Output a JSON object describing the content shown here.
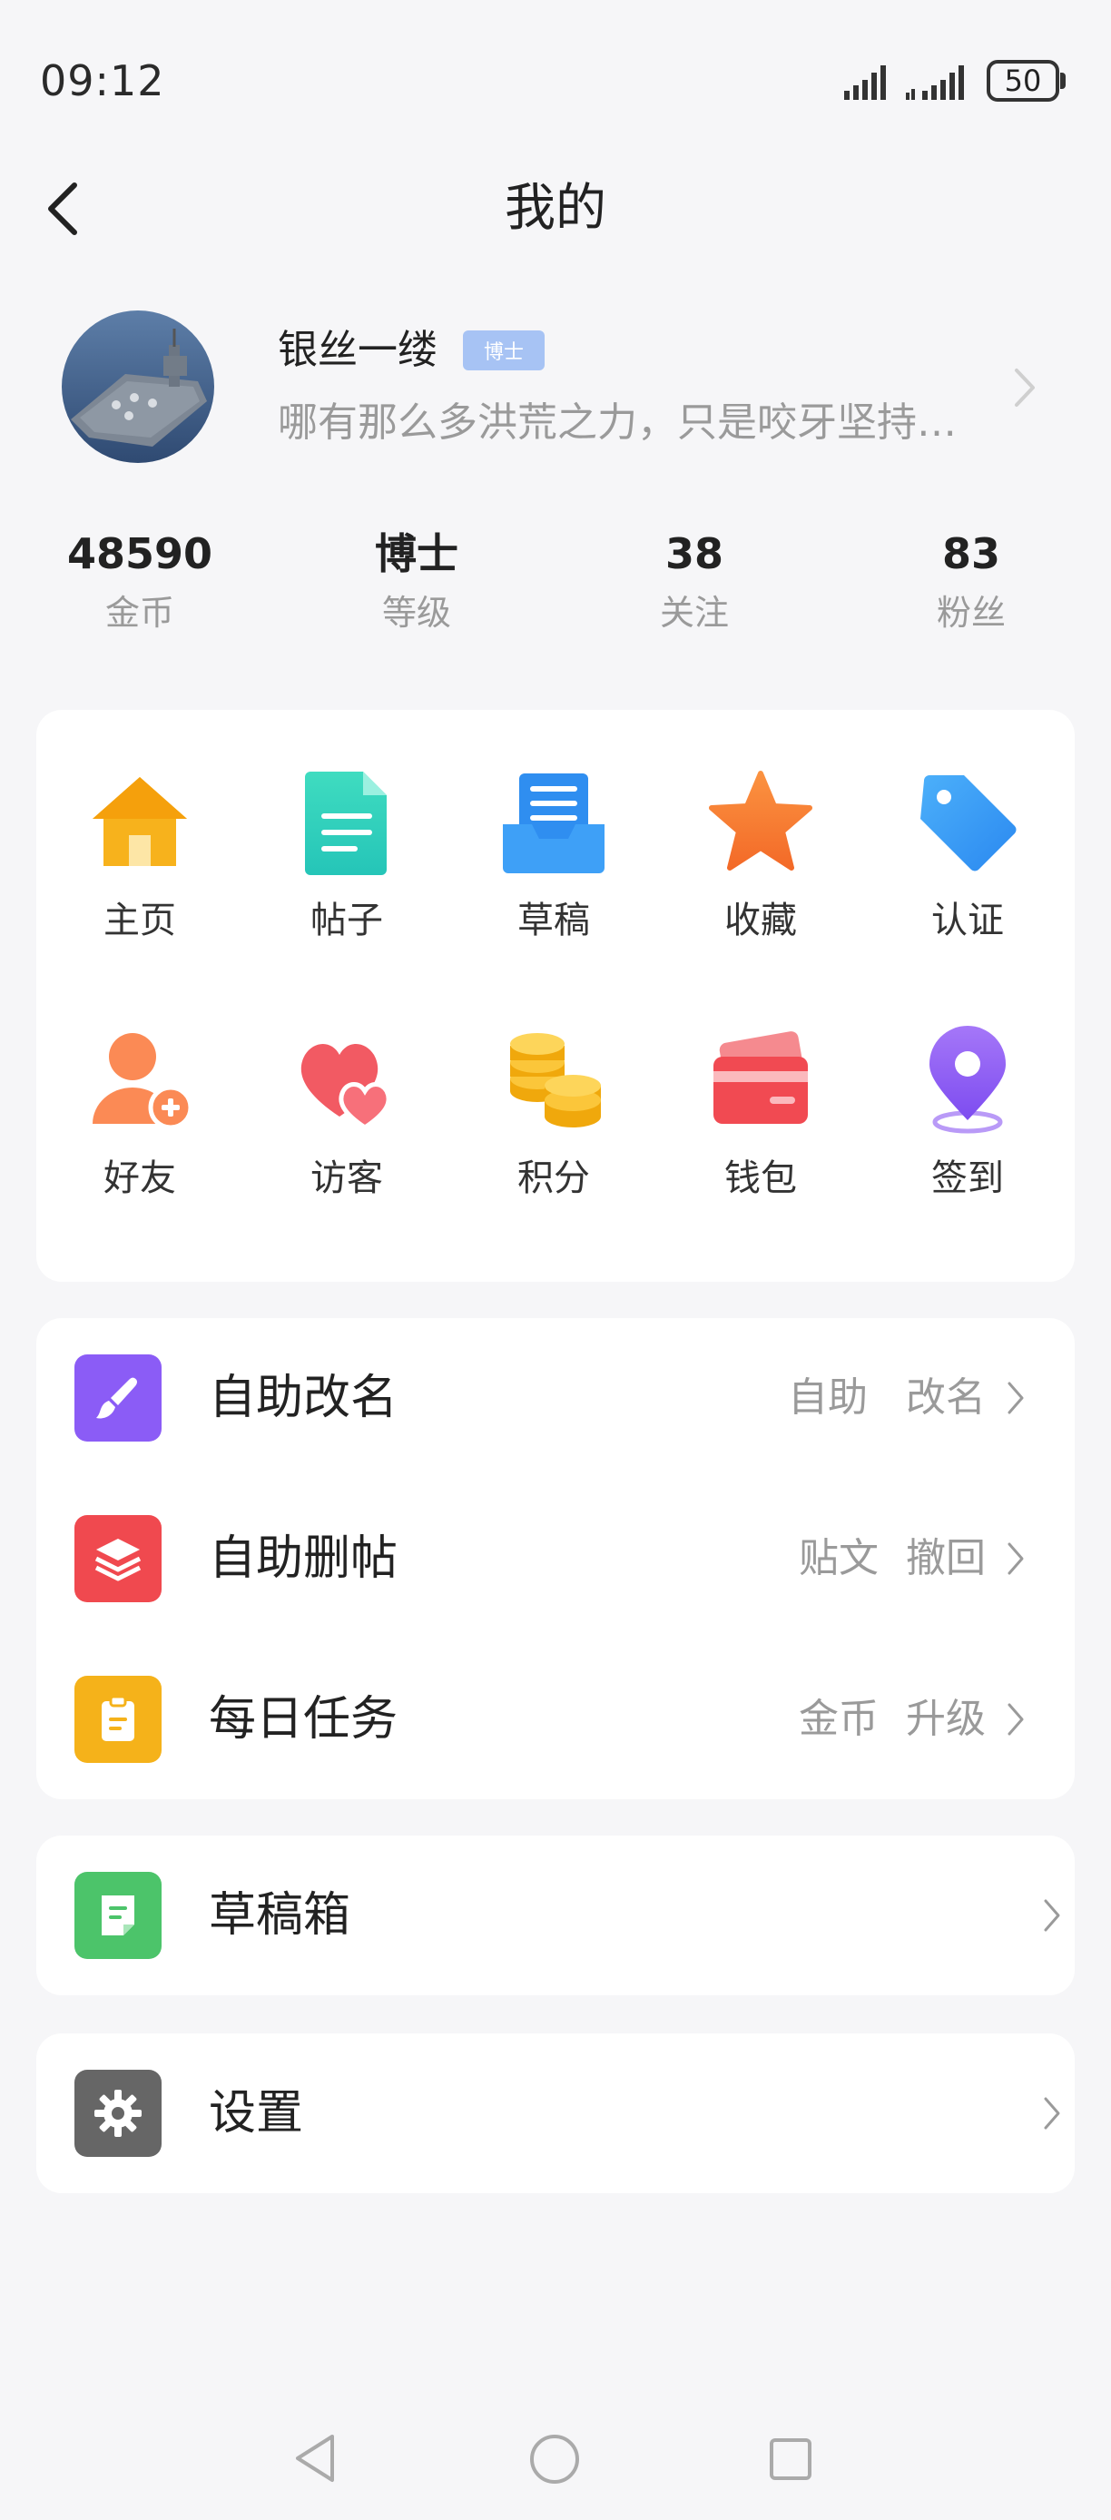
{
  "status_bar": {
    "time": "09:12",
    "battery": "50"
  },
  "header": {
    "title": "我的"
  },
  "profile": {
    "username": "银丝一缕",
    "rank_badge": "博士",
    "signature": "哪有那么多洪荒之力，只是咬牙坚持…"
  },
  "stats": [
    {
      "value": "48590",
      "label": "金币"
    },
    {
      "value": "博士",
      "label": "等级"
    },
    {
      "value": "38",
      "label": "关注"
    },
    {
      "value": "83",
      "label": "粉丝"
    }
  ],
  "grid": [
    {
      "label": "主页",
      "icon": "home-icon"
    },
    {
      "label": "帖子",
      "icon": "document-icon"
    },
    {
      "label": "草稿",
      "icon": "draft-tray-icon"
    },
    {
      "label": "收藏",
      "icon": "star-icon"
    },
    {
      "label": "认证",
      "icon": "tag-icon"
    },
    {
      "label": "好友",
      "icon": "add-friend-icon"
    },
    {
      "label": "访客",
      "icon": "hearts-icon"
    },
    {
      "label": "积分",
      "icon": "coins-icon"
    },
    {
      "label": "钱包",
      "icon": "wallet-card-icon"
    },
    {
      "label": "签到",
      "icon": "location-pin-icon"
    }
  ],
  "menu": [
    {
      "label": "自助改名",
      "right1": "自助",
      "right2": "改名",
      "icon": "brush-icon",
      "color": "#8b5cf6"
    },
    {
      "label": "自助删帖",
      "right1": "贴文",
      "right2": "撤回",
      "icon": "layers-icon",
      "color": "#f0494f"
    },
    {
      "label": "每日任务",
      "right1": "金币",
      "right2": "升级",
      "icon": "clipboard-icon",
      "color": "#f5b21a"
    }
  ],
  "drafts": {
    "label": "草稿箱",
    "icon": "note-icon",
    "color": "#4cc46a"
  },
  "settings": {
    "label": "设置",
    "icon": "gear-icon",
    "color": "#666666"
  }
}
